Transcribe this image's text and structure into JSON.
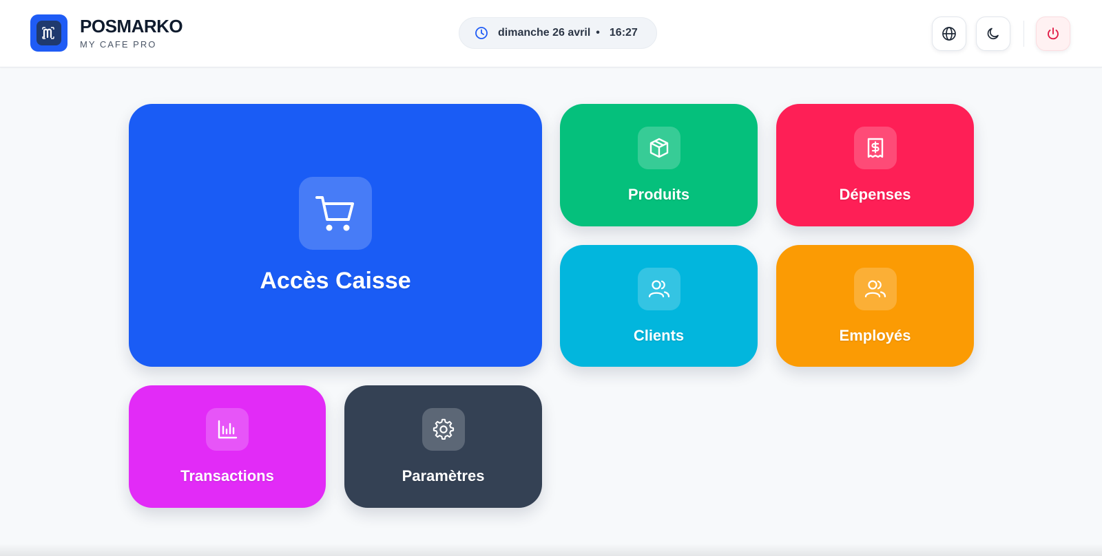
{
  "header": {
    "brand_title": "POSMARKO",
    "brand_subtitle": "MY CAFE PRO",
    "logo_icon": "m-logo-icon",
    "date_text": "dimanche 26 avril",
    "separator": "•",
    "time_text": "16:27",
    "actions": [
      {
        "icon": "globe-icon"
      },
      {
        "icon": "moon-icon"
      },
      {
        "icon": "power-icon",
        "color": "#e11d48"
      }
    ]
  },
  "tiles": {
    "caisse": {
      "label": "Accès Caisse",
      "icon": "cart-icon",
      "color": "#1a5cf5"
    },
    "produits": {
      "label": "Produits",
      "icon": "box-icon",
      "color": "#05c07c"
    },
    "depenses": {
      "label": "Dépenses",
      "icon": "receipt-dollar-icon",
      "color": "#fe1f56"
    },
    "clients": {
      "label": "Clients",
      "icon": "users-icon",
      "color": "#02b6dd"
    },
    "employes": {
      "label": "Employés",
      "icon": "users-icon",
      "color": "#fb9b04"
    },
    "transactions": {
      "label": "Transactions",
      "icon": "bar-chart-icon",
      "color": "#e22bf7"
    },
    "parametres": {
      "label": "Paramètres",
      "icon": "gear-icon",
      "color": "#344154"
    }
  }
}
